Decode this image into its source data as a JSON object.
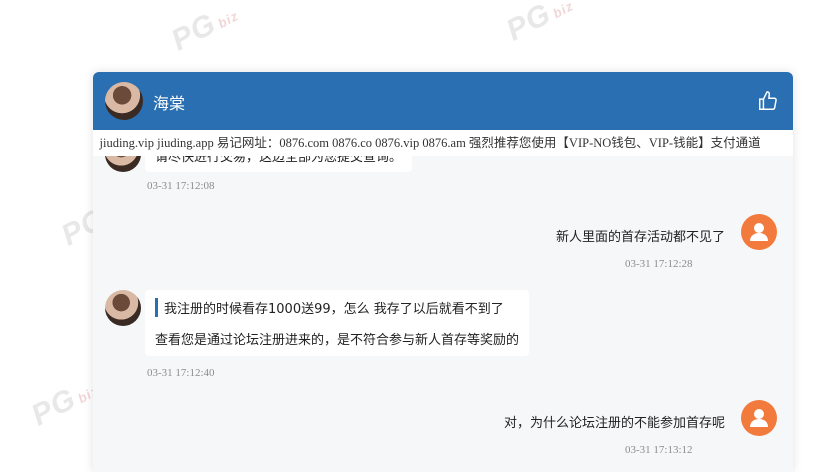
{
  "watermark": {
    "text": "PG",
    "suffix": "biz"
  },
  "chat": {
    "title": "海棠",
    "ticker": "：jiuding.vip jiuding.app 易记网址：0876.com 0876.co 0876.vip 0876.am 强烈推荐您使用【VIP-NO钱包、VIP-钱能】支付通道",
    "messages": [
      {
        "side": "left",
        "text": "请尽快进行交易，这边全部为您提交查询。",
        "time": "03-31 17:12:08"
      },
      {
        "side": "right",
        "text": "新人里面的首存活动都不见了",
        "time": "03-31 17:12:28"
      },
      {
        "side": "left",
        "quote": "我注册的时候看存1000送99，怎么 我存了以后就看不到了",
        "text": "查看您是通过论坛注册进来的，是不符合参与新人首存等奖励的",
        "time": "03-31 17:12:40"
      },
      {
        "side": "right",
        "text": "对，为什么论坛注册的不能参加首存呢",
        "time": "03-31 17:13:12"
      }
    ]
  }
}
